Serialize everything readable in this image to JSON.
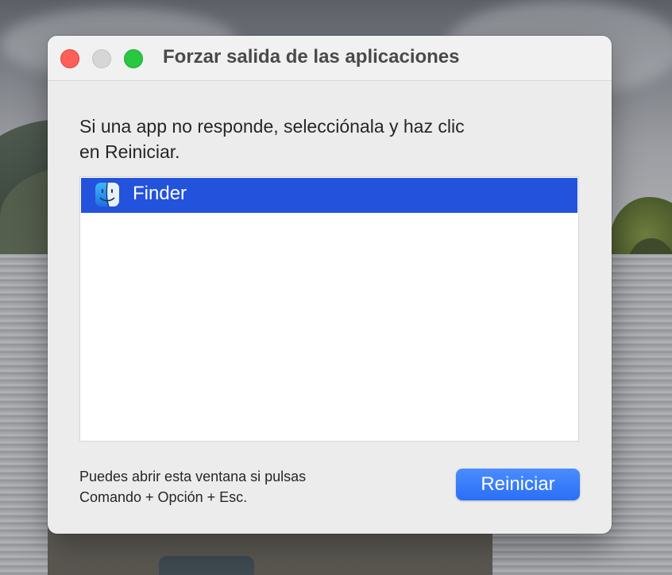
{
  "window": {
    "title": "Forzar salida de las aplicaciones"
  },
  "instructions": {
    "line1": "Si una app no responde, selecciónala y haz clic",
    "line2": "en Reiniciar."
  },
  "app_list": {
    "items": [
      {
        "label": "Finder",
        "icon": "finder-icon",
        "selected": true
      }
    ]
  },
  "hint": {
    "line1": "Puedes abrir esta ventana si pulsas",
    "line2": "Comando + Opción + Esc."
  },
  "actions": {
    "relaunch_label": "Reiniciar"
  },
  "colors": {
    "selection": "#2352dc",
    "button": "#2a6ff6",
    "close": "#fe5f57",
    "zoom": "#28c840"
  }
}
